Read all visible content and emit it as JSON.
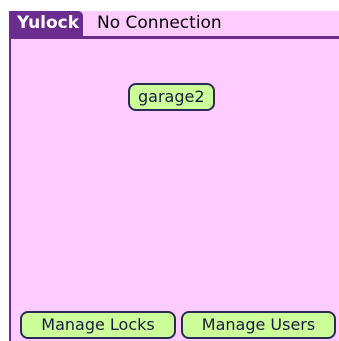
{
  "titlebar": {
    "app_title": "Yulock",
    "status": "No Connection"
  },
  "locks": [
    {
      "label": "garage2"
    }
  ],
  "bottom_bar": {
    "manage_locks_label": "Manage Locks",
    "manage_users_label": "Manage Users"
  },
  "colors": {
    "background": "#ffccff",
    "accent": "#6a2c8f",
    "button_fill": "#ccff99",
    "button_border": "#2b2b5a"
  }
}
